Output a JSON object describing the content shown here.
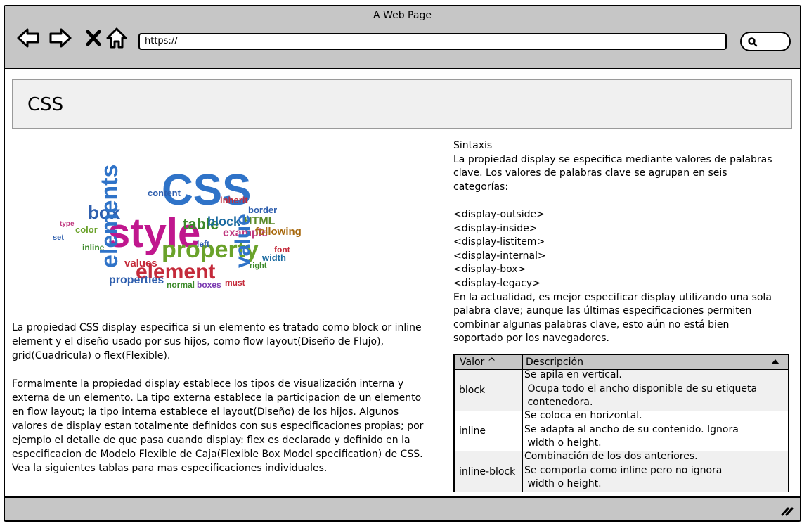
{
  "window": {
    "title": "A Web Page"
  },
  "toolbar": {
    "url": "https://",
    "icons": [
      "back-arrow-icon",
      "forward-arrow-icon",
      "close-x-icon",
      "home-icon",
      "search-icon"
    ]
  },
  "header": {
    "title": "CSS"
  },
  "image": {
    "description_icon": "css-word-cloud-image"
  },
  "left": {
    "p1": "La propiedad CSS display especifica si un elemento es tratado como block or inline element y el diseño usado por sus hijos, como flow layout(Diseño de Flujo), grid(Cuadricula) o flex(Flexible).",
    "p2": "Formalmente la propiedad display establece los tipos de visualización interna y externa de un elemento. La tipo externa establece la participacion de un elemento en flow layout; la tipo interna establece el layout(Diseño) de los hijos. Algunos valores de display estan totalmente definidos con sus especificaciones propias; por ejemplo el detalle de que pasa cuando display: flex es declarado y definido en la especificacion de Modelo Flexible de Caja(Flexible Box Model specification) de CSS. Vea la siguientes tablas para mas especificaciones individuales."
  },
  "right": {
    "text": "Sintaxis\nLa propiedad display se especifica mediante valores de palabras clave. Los valores de palabras clave se agrupan en seis categorías:\n\n<display-outside>\n<display-inside>\n<display-listitem>\n<display-internal>\n<display-box>\n<display-legacy>\nEn la actualidad, es mejor especificar display utilizando una sola palabra clave; aunque las últimas especificaciones permiten combinar algunas palabras clave, esto aún no está bien soportado por los navegadores."
  },
  "table": {
    "headers": [
      "Valor  ^",
      "Descripción"
    ],
    "rows": [
      {
        "value": "block",
        "desc": "Se apila en vertical.\n Ocupa todo el ancho disponible de su etiqueta\n contenedora."
      },
      {
        "value": "inline",
        "desc": "Se coloca en horizontal.\nSe adapta al ancho de su contenido. Ignora\n width o height."
      },
      {
        "value": "inline-block",
        "desc": "Combinación de los dos anteriores.\nSe comporta como inline pero no ignora\n width o height."
      }
    ]
  },
  "colors": {
    "chrome": "#c6c6c6",
    "header_bg": "#f0f0f0"
  }
}
